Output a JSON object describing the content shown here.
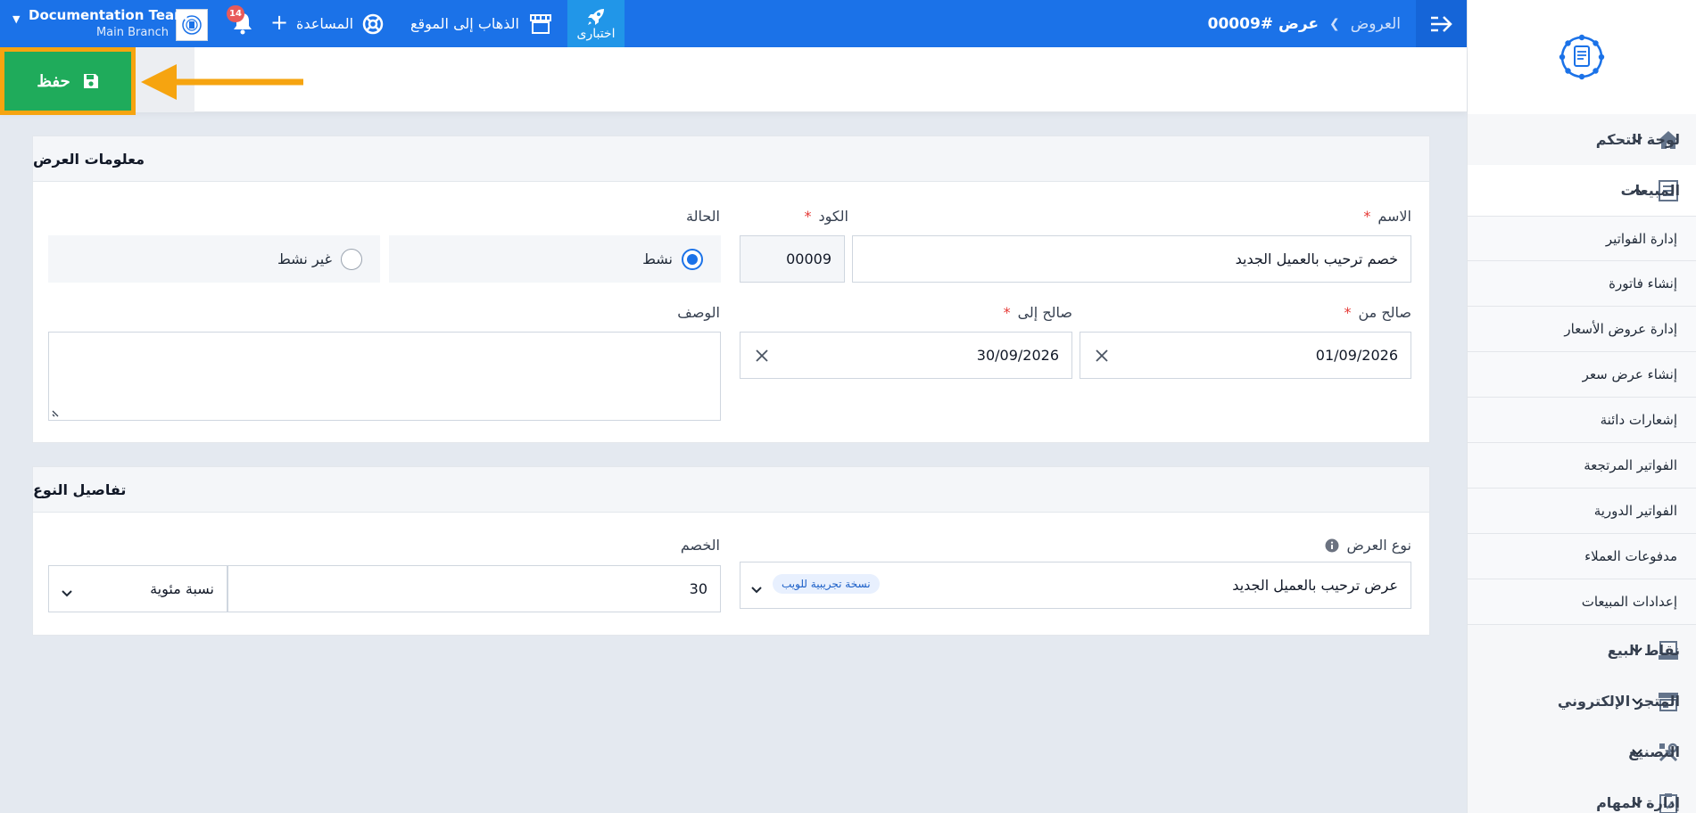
{
  "colors": {
    "primary": "#1b72e8",
    "save": "#1fab5b",
    "highlight": "#f6a410",
    "required": "#e53935"
  },
  "sidebar": {
    "logo_icon": "invoice-logo",
    "sections": [
      {
        "label": "لوحة التحكم",
        "icon": "home-icon",
        "open": false
      },
      {
        "label": "المبيعات",
        "icon": "sales-icon",
        "open": true
      }
    ],
    "sales_items": [
      "إدارة الفواتير",
      "إنشاء فاتورة",
      "إدارة عروض الأسعار",
      "إنشاء عرض سعر",
      "إشعارات دائنة",
      "الفواتير المرتجعة",
      "الفواتير الدورية",
      "مدفوعات العملاء",
      "إعدادات المبيعات"
    ],
    "sections_after": [
      {
        "label": "نقاط البيع",
        "icon": "pos-icon"
      },
      {
        "label": "المتجر الإلكتروني",
        "icon": "store-icon"
      },
      {
        "label": "التصنيع",
        "icon": "tools-icon"
      },
      {
        "label": "إدارة المهام",
        "icon": "tasks-icon"
      }
    ]
  },
  "topbar": {
    "breadcrumb_parent": "العروض",
    "breadcrumb_current": "عرض #00009",
    "trial_label": "اختبارى",
    "goto_site_label": "الذهاب إلى الموقع",
    "help_label": "المساعدة",
    "notifications_count": "14",
    "account_name": "Documentation Team",
    "branch_name": "Main Branch"
  },
  "actions": {
    "save_label": "حفظ"
  },
  "offer_info": {
    "title": "معلومات العرض",
    "name_label": "الاسم",
    "name_value": "خصم ترحيب بالعميل الجديد",
    "code_label": "الكود",
    "code_value": "00009",
    "status_label": "الحالة",
    "status_active": "نشط",
    "status_inactive": "غير نشط",
    "valid_from_label": "صالح من",
    "valid_from_value": "01/09/2026",
    "valid_to_label": "صالح إلى",
    "valid_to_value": "30/09/2026",
    "description_label": "الوصف",
    "description_value": ""
  },
  "type_details": {
    "title": "تفاصيل النوع",
    "offer_type_label": "نوع العرض",
    "offer_type_value": "عرض ترحيب بالعميل الجديد",
    "offer_type_tag": "نسخة تجريبية للويب",
    "discount_label": "الخصم",
    "discount_value": "30",
    "discount_unit": "نسبة مئوية"
  }
}
